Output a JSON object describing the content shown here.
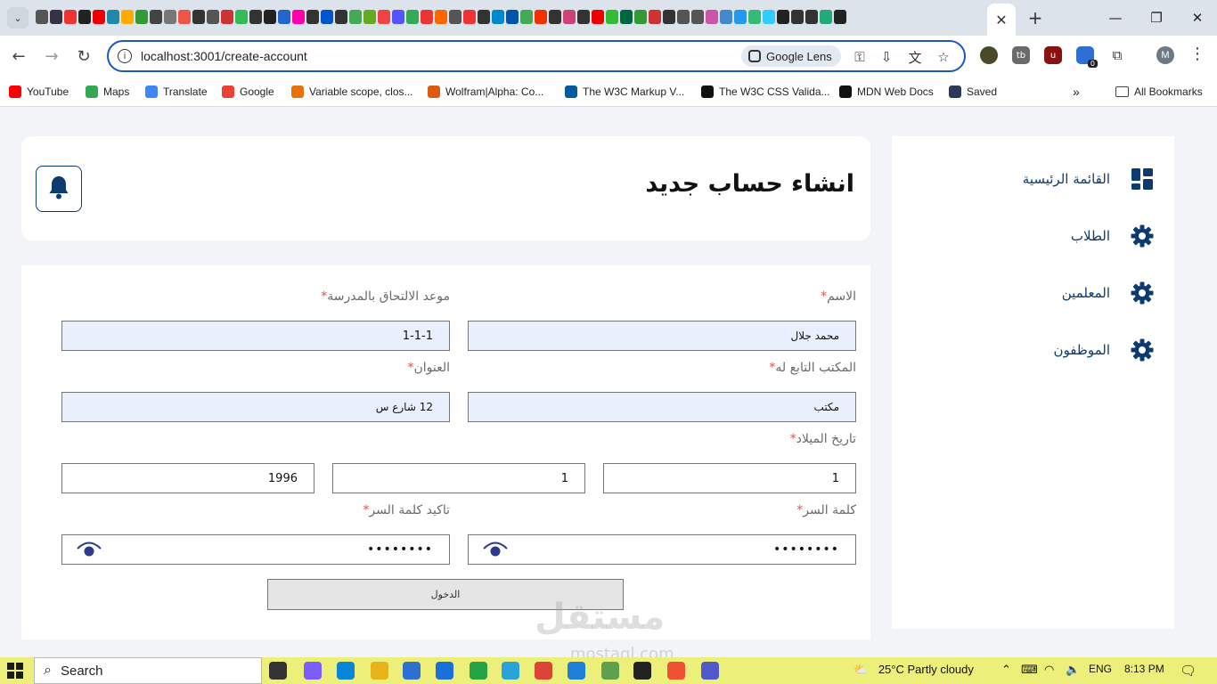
{
  "browser": {
    "url": "localhost:3001/create-account",
    "lens_label": "Google Lens",
    "profile_initial": "M",
    "extension_badge": "0",
    "bookmarks": [
      {
        "label": "YouTube",
        "color": "#ff0000"
      },
      {
        "label": "Maps",
        "color": "#34a853"
      },
      {
        "label": "Translate",
        "color": "#4285f4"
      },
      {
        "label": "Google",
        "color": "#ea4335"
      },
      {
        "label": "Variable scope, clos...",
        "color": "#e8710a"
      },
      {
        "label": "Wolfram|Alpha: Co...",
        "color": "#dd5b10"
      },
      {
        "label": "The W3C Markup V...",
        "color": "#005a9c"
      },
      {
        "label": "The W3C CSS Valida...",
        "color": "#111111"
      },
      {
        "label": "MDN Web Docs",
        "color": "#111111"
      },
      {
        "label": "Saved",
        "color": "#2b3a55"
      }
    ],
    "all_bookmarks_label": "All Bookmarks"
  },
  "sidebar": {
    "items": [
      {
        "label": "القائمة الرئيسية",
        "icon": "dashboard-icon"
      },
      {
        "label": "الطلاب",
        "icon": "gear-icon"
      },
      {
        "label": "المعلمين",
        "icon": "gear-icon"
      },
      {
        "label": "الموظفون",
        "icon": "gear-icon"
      }
    ]
  },
  "header": {
    "title": "انشاء حساب جديد"
  },
  "form": {
    "name_label": "الاسم",
    "name_value": "محمد جلال",
    "enrollment_label": "موعد الالتحاق بالمدرسة",
    "enrollment_value": "1-1-1",
    "office_label": "المكتب التابع له",
    "office_value": "مكتب",
    "address_label": "العنوان",
    "address_value": "12 شارع س",
    "birthdate_label": "تاريخ الميلاد",
    "birth_day": "1",
    "birth_month": "1",
    "birth_year": "1996",
    "password_label": "كلمة السر",
    "password_value": "••••••••",
    "confirm_label": "تاكيد كلمة السر",
    "confirm_value": "••••••••",
    "required_mark": "*",
    "submit_label": "الدخول"
  },
  "watermark": {
    "text": "مستقل",
    "sub": "mostaql.com"
  },
  "taskbar": {
    "search_label": "Search",
    "weather": "25°C  Partly cloudy",
    "language": "ENG",
    "time": "8:13 PM"
  },
  "colors": {
    "accent": "#0d3b70",
    "omnibox_border": "#1a57c4",
    "required": "#d9534f",
    "autofill_bg": "#e8f0fe",
    "taskbar": "#ecef7a"
  }
}
